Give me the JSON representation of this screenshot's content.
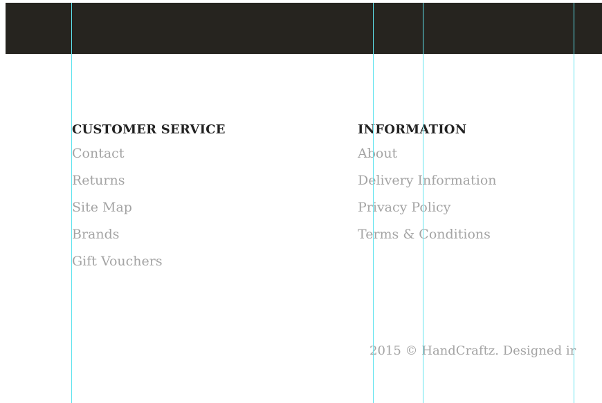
{
  "footer": {
    "customer_service": {
      "heading": "CUSTOMER SERVICE",
      "links": [
        "Contact",
        "Returns",
        "Site Map",
        "Brands",
        "Gift Vouchers"
      ]
    },
    "information": {
      "heading": "INFORMATION",
      "links": [
        "About",
        "Delivery Information",
        "Privacy Policy",
        "Terms & Conditions"
      ]
    },
    "copyright": "2015 © HandCraftz. Designed ir"
  },
  "colors": {
    "header_bar": "#26241f",
    "heading_text": "#222222",
    "link_text": "#a4a4a4",
    "guide_line": "#5fe3ee"
  }
}
